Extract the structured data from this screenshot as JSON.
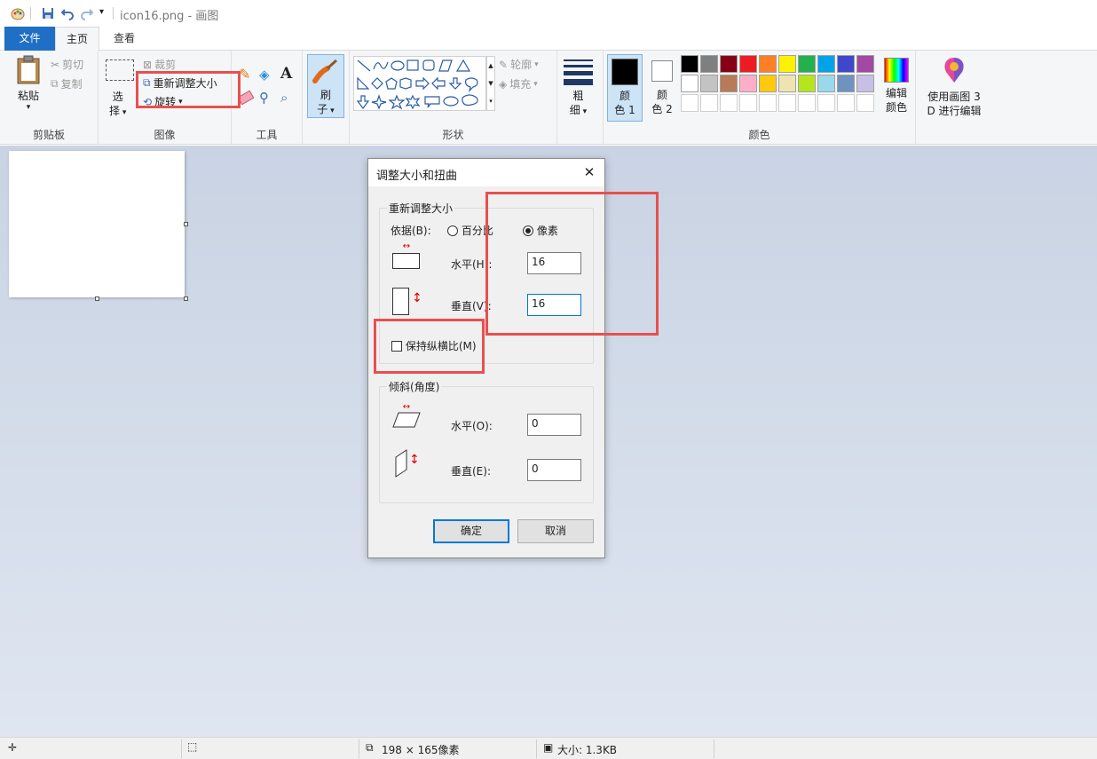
{
  "window": {
    "title": "icon16.png - 画图"
  },
  "tabs": [
    {
      "label": "文件"
    },
    {
      "label": "主页"
    },
    {
      "label": "查看"
    }
  ],
  "ribbon": {
    "clipboard": {
      "paste": "粘贴",
      "cut": "剪切",
      "copy": "复制",
      "group": "剪贴板"
    },
    "image": {
      "select": "选",
      "select2": "择",
      "crop": "裁剪",
      "resize": "重新调整大小",
      "rotate": "旋转",
      "group": "图像"
    },
    "tools": {
      "group": "工具",
      "text_tool": "A"
    },
    "brushes": {
      "label1": "刷",
      "label2": "子"
    },
    "shapes": {
      "outline": "轮廓",
      "fill": "填充",
      "group": "形状"
    },
    "size": {
      "label1": "粗",
      "label2": "细"
    },
    "colors": {
      "color1_a": "颜",
      "color1_b": "色 1",
      "color2_a": "颜",
      "color2_b": "色 2",
      "edit_a": "编辑",
      "edit_b": "颜色",
      "group": "颜色",
      "palette_row1": [
        "#000000",
        "#7f7f7f",
        "#880015",
        "#ed1c24",
        "#ff7f27",
        "#fff200",
        "#22b14c",
        "#00a2e8",
        "#3f48cc",
        "#a349a4"
      ],
      "palette_row2": [
        "#ffffff",
        "#c3c3c3",
        "#b97a57",
        "#ffaec9",
        "#ffc90e",
        "#efe4b0",
        "#b5e61d",
        "#99d9ea",
        "#7092be",
        "#c8bfe7"
      ],
      "palette_row3": [
        "#ffffff",
        "#ffffff",
        "#ffffff",
        "#ffffff",
        "#ffffff",
        "#ffffff",
        "#ffffff",
        "#ffffff",
        "#ffffff",
        "#ffffff"
      ]
    },
    "paint3d": {
      "label1": "使用画图 3",
      "label2": "D 进行编辑"
    }
  },
  "dialog": {
    "title": "调整大小和扭曲",
    "close": "✕",
    "resize_group": "重新调整大小",
    "by_label": "依据(B):",
    "by_key": "B",
    "percent": "百分比",
    "pixels": "像素",
    "horizontal": "水平(H):",
    "vertical": "垂直(V):",
    "h_value": "16",
    "v_value": "16",
    "keep_ratio": "保持纵横比(M)",
    "skew_group": "倾斜(角度)",
    "skew_h_label": "水平(O):",
    "skew_v_label": "垂直(E):",
    "skew_h": "0",
    "skew_v": "0",
    "ok": "确定",
    "cancel": "取消"
  },
  "status": {
    "selection_size": "198 × 165像素",
    "file_size": "大小: 1.3KB"
  }
}
